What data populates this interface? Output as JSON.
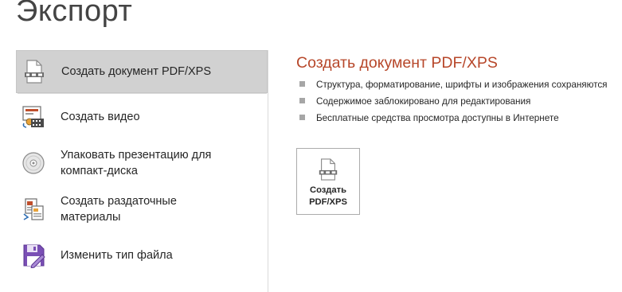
{
  "page": {
    "title": "Экспорт"
  },
  "sidebar": {
    "items": [
      {
        "label": "Создать документ PDF/XPS",
        "icon": "pdf-document-icon",
        "selected": true
      },
      {
        "label": "Создать видео",
        "icon": "video-icon",
        "selected": false
      },
      {
        "label_line1": "Упаковать презентацию для",
        "label_line2": "компакт-диска",
        "icon": "cd-icon",
        "selected": false
      },
      {
        "label_line1": "Создать раздаточные",
        "label_line2": "материалы",
        "icon": "handouts-icon",
        "selected": false
      },
      {
        "label": "Изменить тип файла",
        "icon": "save-floppy-icon",
        "selected": false
      }
    ]
  },
  "detail": {
    "title": "Создать документ PDF/XPS",
    "bullets": [
      "Структура, форматирование, шрифты и изображения сохраняются",
      "Содержимое заблокировано для редактирования",
      "Бесплатные средства просмотра доступны в Интернете"
    ],
    "button": {
      "line1": "Создать",
      "line2": "PDF/XPS",
      "icon": "pdf-document-icon"
    }
  },
  "colors": {
    "accent": "#b7472a",
    "selected_bg": "#d1d1d1",
    "divider": "#dadada",
    "bullet": "#a6a6a6"
  }
}
